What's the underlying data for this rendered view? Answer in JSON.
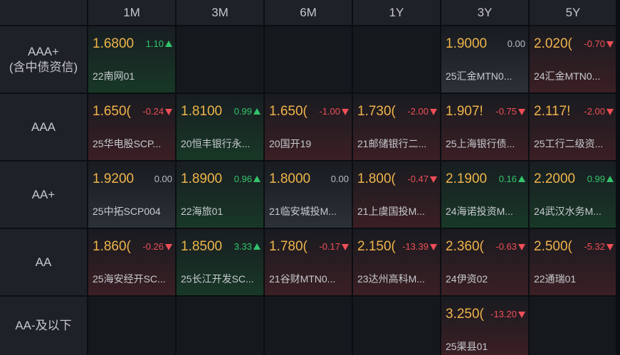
{
  "columns": [
    "1M",
    "3M",
    "6M",
    "1Y",
    "3Y",
    "5Y"
  ],
  "rows": [
    {
      "label_line1": "AAA+",
      "label_line2": "(含中债资信)",
      "cells": [
        {
          "rate": "1.6800",
          "change": "1.10",
          "dir": "up",
          "name": "22南网01"
        },
        null,
        null,
        null,
        {
          "rate": "1.9000",
          "change": "0.00",
          "dir": "flat",
          "name": "25汇金MTN0..."
        },
        {
          "rate": "2.020(",
          "change": "-0.70",
          "dir": "down",
          "name": "24汇金MTN0..."
        }
      ]
    },
    {
      "label_line1": "AAA",
      "label_line2": "",
      "cells": [
        {
          "rate": "1.650(",
          "change": "-0.24",
          "dir": "down",
          "name": "25华电股SCP..."
        },
        {
          "rate": "1.8100",
          "change": "0.99",
          "dir": "up",
          "name": "20恒丰银行永..."
        },
        {
          "rate": "1.650(",
          "change": "-1.00",
          "dir": "down",
          "name": "20国开19"
        },
        {
          "rate": "1.730(",
          "change": "-2.00",
          "dir": "down",
          "name": "21邮储银行二..."
        },
        {
          "rate": "1.907!",
          "change": "-0.75",
          "dir": "down",
          "name": "25上海银行债..."
        },
        {
          "rate": "2.117!",
          "change": "-2.00",
          "dir": "down",
          "name": "25工行二级资..."
        }
      ]
    },
    {
      "label_line1": "AA+",
      "label_line2": "",
      "cells": [
        {
          "rate": "1.9200",
          "change": "0.00",
          "dir": "flat",
          "name": "25中拓SCP004"
        },
        {
          "rate": "1.8900",
          "change": "0.96",
          "dir": "up",
          "name": "22海旅01"
        },
        {
          "rate": "1.8000",
          "change": "0.00",
          "dir": "flat",
          "name": "21临安城投M..."
        },
        {
          "rate": "1.800(",
          "change": "-0.47",
          "dir": "down",
          "name": "21上虞国投M..."
        },
        {
          "rate": "2.1900",
          "change": "0.16",
          "dir": "up",
          "name": "24海诺投资M..."
        },
        {
          "rate": "2.2000",
          "change": "0.99",
          "dir": "up",
          "name": "24武汉水务M..."
        }
      ]
    },
    {
      "label_line1": "AA",
      "label_line2": "",
      "cells": [
        {
          "rate": "1.860(",
          "change": "-0.26",
          "dir": "down",
          "name": "25海安经开SC..."
        },
        {
          "rate": "1.8500",
          "change": "3.33",
          "dir": "up",
          "name": "25长江开发SC..."
        },
        {
          "rate": "1.780(",
          "change": "-0.17",
          "dir": "down",
          "name": "21谷财MTN0..."
        },
        {
          "rate": "2.150(",
          "change": "-13.39",
          "dir": "down",
          "name": "23达州高科M..."
        },
        {
          "rate": "2.360(",
          "change": "-0.63",
          "dir": "down",
          "name": "24伊资02"
        },
        {
          "rate": "2.500(",
          "change": "-5.32",
          "dir": "down",
          "name": "22通瑞01"
        }
      ]
    },
    {
      "label_line1": "AA-及以下",
      "label_line2": "",
      "cells": [
        null,
        null,
        null,
        null,
        {
          "rate": "3.250(",
          "change": "-13.20",
          "dir": "down",
          "name": "25渠县01"
        },
        null
      ]
    }
  ]
}
